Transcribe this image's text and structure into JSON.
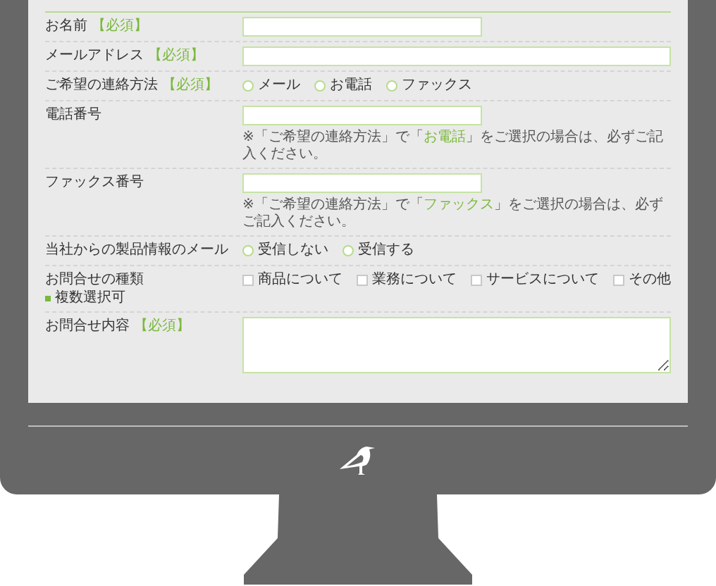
{
  "fields": [
    {
      "kind": "short-text",
      "label": "お名前",
      "required": "【必須】"
    },
    {
      "kind": "long-text",
      "label": "メールアドレス",
      "required": "【必須】"
    },
    {
      "kind": "radio",
      "label": "ご希望の連絡方法",
      "required": "【必須】",
      "options": [
        {
          "label": "メール",
          "selected": false
        },
        {
          "label": "お電話",
          "selected": false
        },
        {
          "label": "ファックス",
          "selected": false
        }
      ]
    },
    {
      "kind": "short-text",
      "label": "電話番号",
      "note": {
        "before": "※「ご希望の連絡方法」で「",
        "highlight": "お電話",
        "after": "」をご選択の場合は、必ずご記入ください。"
      }
    },
    {
      "kind": "short-text",
      "label": "ファックス番号",
      "note": {
        "before": "※「ご希望の連絡方法」で「",
        "highlight": "ファックス",
        "after": "」をご選択の場合は、必ずご記入ください。"
      }
    },
    {
      "kind": "radio",
      "label": "当社からの製品情報のメール",
      "options": [
        {
          "label": "受信しない",
          "selected": false
        },
        {
          "label": "受信する",
          "selected": false
        }
      ]
    },
    {
      "kind": "checkbox",
      "label": "お問合せの種類",
      "sublabel": "複数選択可",
      "options": [
        {
          "label": "商品について",
          "checked": false
        },
        {
          "label": "業務について",
          "checked": false
        },
        {
          "label": "サービスについて",
          "checked": false
        },
        {
          "label": "その他",
          "checked": false
        }
      ]
    },
    {
      "kind": "textarea",
      "label": "お問合せ内容",
      "required": "【必須】"
    }
  ]
}
